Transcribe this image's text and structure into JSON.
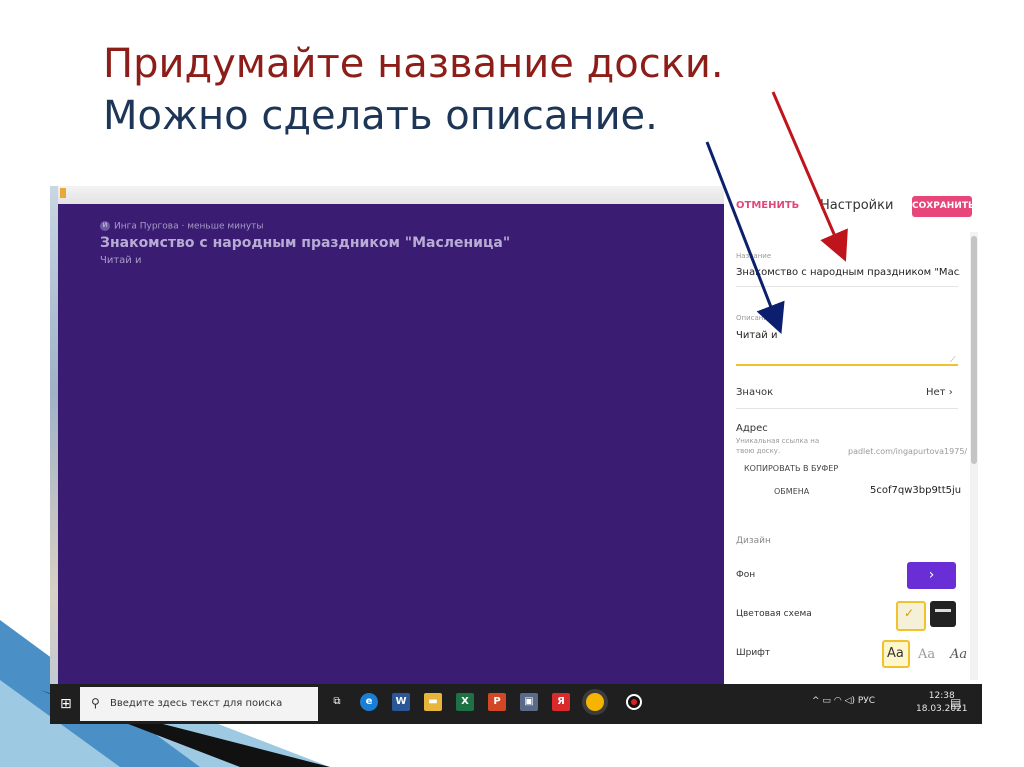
{
  "slide": {
    "title_line1": "Придумайте название доски.",
    "title_line2": "Можно сделать описание."
  },
  "board": {
    "author": "Инга Пургова",
    "author_initial": "И",
    "time": "меньше минуты",
    "title": "Знакомство с народным праздником \"Масленица\"",
    "description": "Читай и"
  },
  "settings": {
    "cancel": "ОТМЕНИТЬ",
    "title": "Настройки",
    "save": "СОХРАНИТЬ",
    "name_label": "Название",
    "name_value": "Знакомство с народным праздником \"Масле",
    "desc_label": "Описание",
    "desc_value": "Читай и",
    "icon_label": "Значок",
    "icon_value": "Нет",
    "address_label": "Адрес",
    "address_hint_1": "Уникальная ссылка на",
    "address_hint_2": "твою доску.",
    "address_url": "padlet.com/ingapurtova1975/",
    "copy_button": "КОПИРОВАТЬ В БУФЕР",
    "exchange_label": "ОБМЕНА",
    "address_code": "5cof7qw3bp9tt5ju",
    "design_label": "Дизайн",
    "background_label": "Фон",
    "color_scheme_label": "Цветовая схема",
    "font_label": "Шрифт",
    "font_sample": "Aa"
  },
  "taskbar": {
    "search_placeholder": "Введите здесь текст для поиска",
    "lang": "РУС",
    "time": "12:38",
    "date": "18.03.2021"
  },
  "colors": {
    "board_bg": "#3a1c72",
    "accent_pink": "#e8457a",
    "accent_purple": "#6a2ed6",
    "arrow_red": "#c0141c",
    "arrow_blue": "#0b1f6e"
  }
}
